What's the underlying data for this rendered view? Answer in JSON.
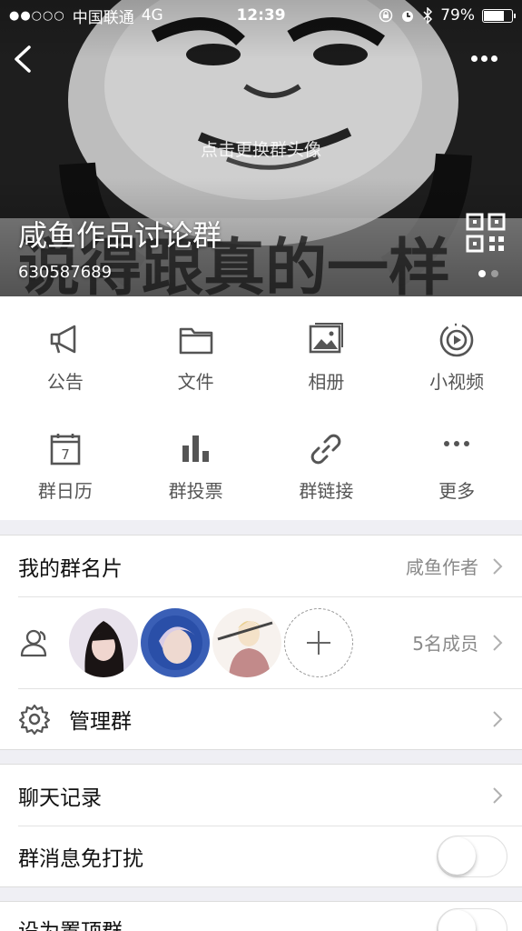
{
  "status_bar": {
    "signal_dots": "●●○○○",
    "carrier": "中国联通",
    "network": "4G",
    "time": "12:39",
    "battery_percent": "79%",
    "battery_level": 0.79
  },
  "header": {
    "change_avatar_hint": "点击更换群头像",
    "group_name": "咸鱼作品讨论群",
    "group_id": "630587689"
  },
  "functions": [
    {
      "label": "公告",
      "icon": "megaphone-icon"
    },
    {
      "label": "文件",
      "icon": "folder-icon"
    },
    {
      "label": "相册",
      "icon": "photo-album-icon"
    },
    {
      "label": "小视频",
      "icon": "video-play-icon"
    },
    {
      "label": "群日历",
      "icon": "calendar-icon"
    },
    {
      "label": "群投票",
      "icon": "bar-chart-icon"
    },
    {
      "label": "群链接",
      "icon": "link-icon"
    },
    {
      "label": "更多",
      "icon": "more-dots-icon"
    }
  ],
  "calendar_day": "7",
  "section1": {
    "my_card_label": "我的群名片",
    "my_card_value": "咸鱼作者",
    "members_value": "5名成员",
    "manage_label": "管理群"
  },
  "section2": {
    "chat_history_label": "聊天记录",
    "mute_label": "群消息免打扰",
    "mute_on": false
  },
  "section3": {
    "pin_label": "设为置顶群",
    "pin_on": false
  },
  "colors": {
    "icon_gray": "#555555",
    "background": "#efeff4"
  }
}
